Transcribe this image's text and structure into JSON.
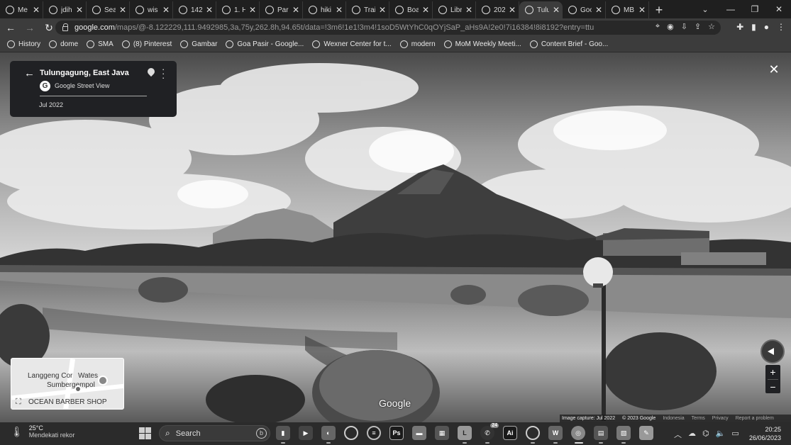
{
  "browser": {
    "tabs": [
      {
        "title": "Me",
        "icon": "chrome-icon"
      },
      {
        "title": "jdih",
        "icon": "site-icon"
      },
      {
        "title": "Sea",
        "icon": "site-icon"
      },
      {
        "title": "wis",
        "icon": "chrome-icon"
      },
      {
        "title": "142",
        "icon": "document-icon"
      },
      {
        "title": "1. H",
        "icon": "diamond-icon"
      },
      {
        "title": "Par",
        "icon": "image-icon"
      },
      {
        "title": "hiki",
        "icon": "chrome-icon"
      },
      {
        "title": "Trai",
        "icon": "globe-icon"
      },
      {
        "title": "Boa",
        "icon": "board-icon"
      },
      {
        "title": "Libr",
        "icon": "library-icon"
      },
      {
        "title": "202",
        "icon": "drive-icon"
      },
      {
        "title": "Tulu",
        "icon": "map-pin-icon",
        "active": true
      },
      {
        "title": "Goo",
        "icon": "google-icon"
      },
      {
        "title": "MB",
        "icon": "chrome-icon"
      }
    ],
    "new_tab": "+",
    "url_host": "google.com",
    "url_rest": "/maps/@-8.122229,111.9492985,3a,75y,262.8h,94.65t/data=!3m6!1e1!3m4!1soD5WtYhC0qOYjSaP_aHs9A!2e0!7i16384!8i8192?entry=ttu",
    "bookmarks": [
      {
        "label": "History",
        "icon": "history-icon"
      },
      {
        "label": "dome",
        "icon": "w-icon"
      },
      {
        "label": "SMA",
        "icon": "globe-icon"
      },
      {
        "label": "(8) Pinterest",
        "icon": "pinterest-icon"
      },
      {
        "label": "Gambar",
        "icon": "gambar-icon"
      },
      {
        "label": "Goa Pasir - Google...",
        "icon": "google-icon"
      },
      {
        "label": "Wexner Center for t...",
        "icon": "wexner-icon"
      },
      {
        "label": "modern",
        "icon": "wordpress-icon"
      },
      {
        "label": "MoM Weekly Meeti...",
        "icon": "doc-icon"
      },
      {
        "label": "Content Brief - Goo...",
        "icon": "drive-icon"
      }
    ]
  },
  "streetview": {
    "place": "Tulungagung, East Java",
    "provider": "Google Street View",
    "date": "Jul 2022",
    "watermark": "Google",
    "minimap": {
      "label1": "Langgeng Cor",
      "label2": "Wates",
      "label3": "Sumbergempol",
      "label4": "OCEAN BARBER SHOP"
    },
    "footer": {
      "capture": "Image capture: Jul 2022",
      "copyright": "© 2023 Google",
      "country": "Indonesia",
      "terms": "Terms",
      "privacy": "Privacy",
      "report": "Report a problem"
    },
    "zoom_in": "+",
    "zoom_out": "−"
  },
  "taskbar": {
    "temp": "25°C",
    "weather_text": "Mendekati rekor",
    "search_label": "Search",
    "time": "20:25",
    "date": "26/06/2023",
    "badge_count": "24"
  }
}
